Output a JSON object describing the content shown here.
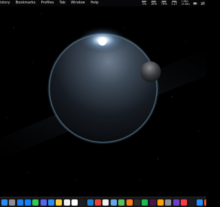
{
  "menubar": {
    "menus": [
      "istory",
      "Bookmarks",
      "Profiles",
      "Tab",
      "Window",
      "Help"
    ],
    "stats": [
      {
        "name": "cpu-usage",
        "value": "5%"
      },
      {
        "name": "gpu-usage",
        "value": "30%"
      },
      {
        "name": "memory-usage",
        "value": "79%"
      },
      {
        "name": "disk-usage",
        "value": "1.2T"
      }
    ],
    "network": {
      "up": "1 KB/s",
      "down": "25 KB/s"
    }
  },
  "wallpaper": {
    "description_icon": "planet-wallpaper"
  },
  "dock": {
    "apps": [
      {
        "name": "finder",
        "color": "#2f8cf0"
      },
      {
        "name": "launchpad",
        "color": "#8e8e93"
      },
      {
        "name": "app-store",
        "color": "#1e7cf2"
      },
      {
        "name": "safari",
        "color": "#0a84ff"
      },
      {
        "name": "messages",
        "color": "#34c759"
      },
      {
        "name": "discord",
        "color": "#5865f2"
      },
      {
        "name": "mail",
        "color": "#2b8ef6"
      },
      {
        "name": "notes",
        "color": "#f5d03b"
      },
      {
        "name": "photos",
        "color": "#f2f2f2"
      },
      {
        "name": "calendar",
        "color": "#ffffff"
      },
      {
        "name": "terminal",
        "color": "#1c1c1e"
      },
      {
        "name": "vscode",
        "color": "#1f7fd1"
      },
      {
        "name": "chrome",
        "color": "#e94335"
      },
      {
        "name": "notion",
        "color": "#f0f0f0"
      },
      {
        "name": "preview",
        "color": "#6aa6e8"
      },
      {
        "name": "maps",
        "color": "#5bc25b"
      },
      {
        "name": "firefox",
        "color": "#ff7a1a"
      },
      {
        "name": "activity-monitor",
        "color": "#2d2d2d"
      },
      {
        "name": "spotify",
        "color": "#1db954"
      },
      {
        "name": "slack",
        "color": "#4a154b"
      },
      {
        "name": "reminders",
        "color": "#ff9f0a"
      },
      {
        "name": "system-settings",
        "color": "#8e8e93"
      },
      {
        "name": "github-desktop",
        "color": "#6e40c9"
      },
      {
        "name": "music",
        "color": "#fc3c44"
      },
      {
        "name": "tv",
        "color": "#1c1c1e"
      },
      {
        "name": "xcode",
        "color": "#1e90ff"
      },
      {
        "name": "figma",
        "color": "#f24e1e"
      },
      {
        "name": "podcasts",
        "color": "#b150e2"
      },
      {
        "name": "downloads",
        "color": "#4c7fd8"
      },
      {
        "name": "trash",
        "color": "#a9a9ae"
      }
    ]
  }
}
